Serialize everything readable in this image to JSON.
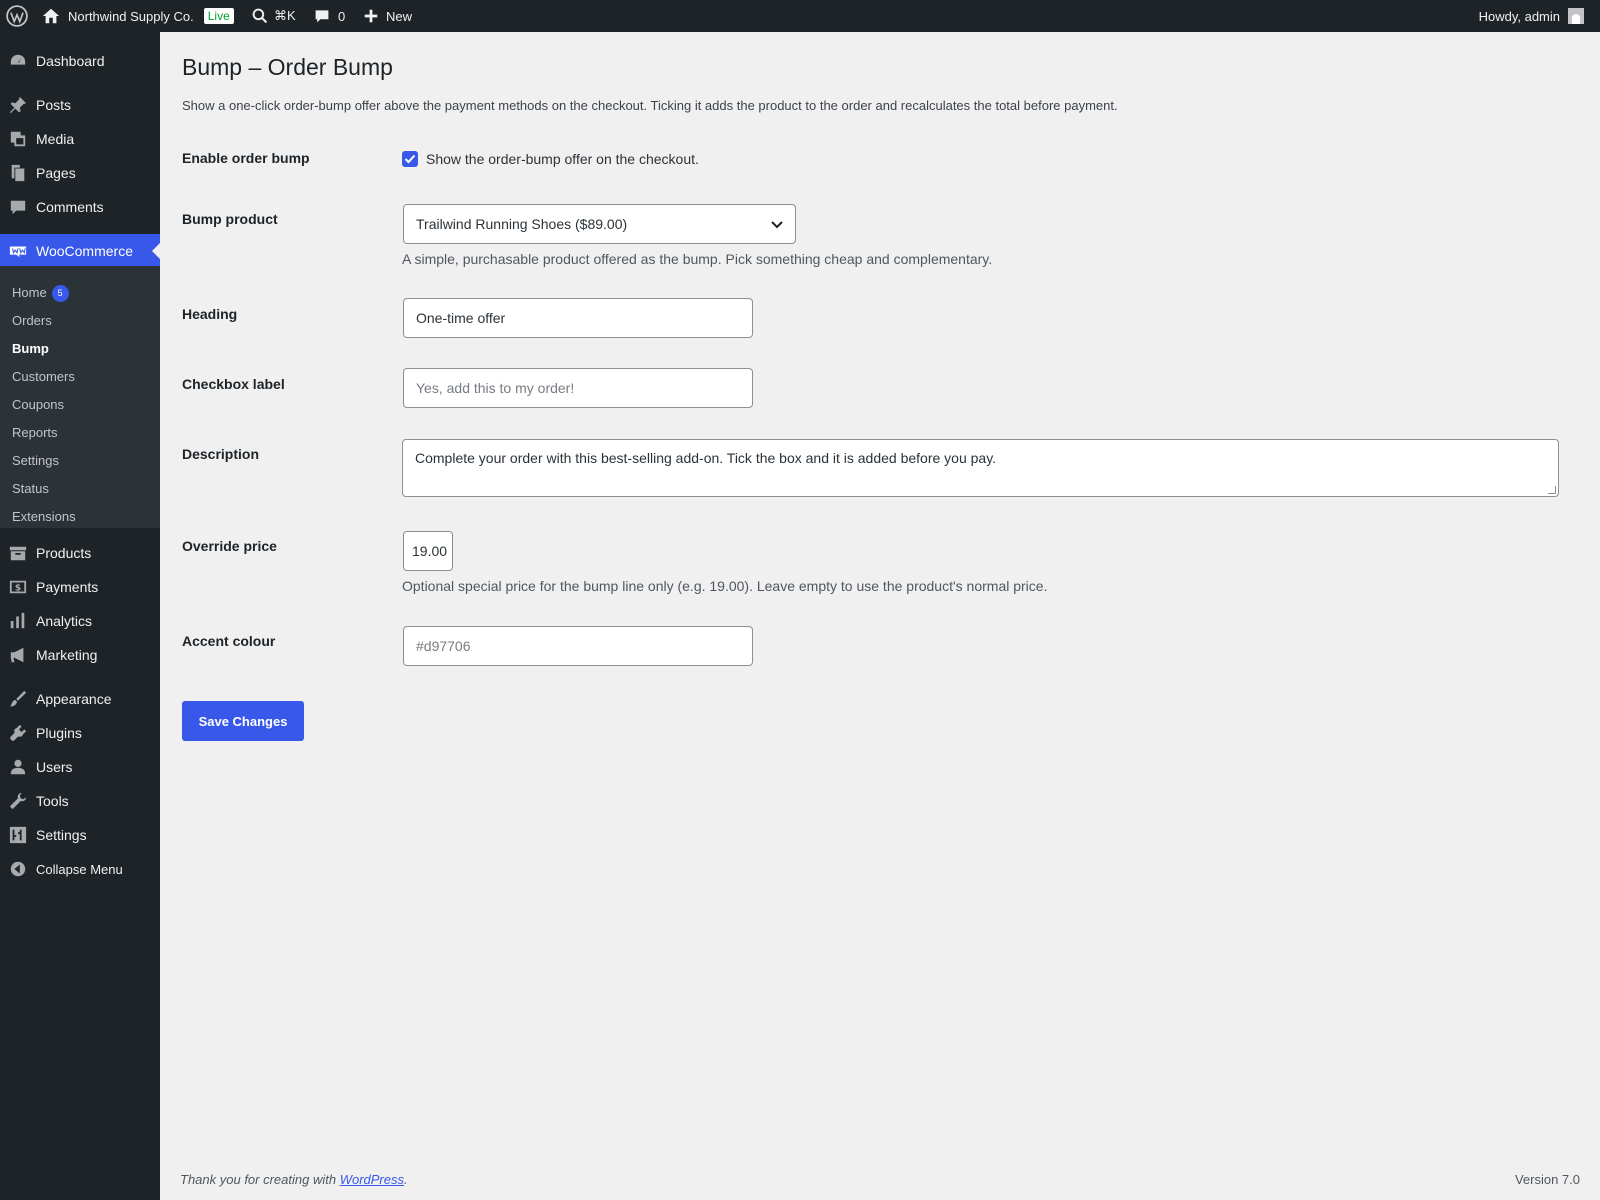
{
  "admin_bar": {
    "site_name": "Northwind Supply Co.",
    "live_badge": "Live",
    "search_shortcut": "⌘K",
    "comments_count": "0",
    "new_label": "New",
    "greeting": "Howdy, admin"
  },
  "sidebar": {
    "dashboard": "Dashboard",
    "posts": "Posts",
    "media": "Media",
    "pages": "Pages",
    "comments": "Comments",
    "woocommerce": "WooCommerce",
    "submenu": {
      "home": "Home",
      "home_badge": "5",
      "orders": "Orders",
      "bump": "Bump",
      "customers": "Customers",
      "coupons": "Coupons",
      "reports": "Reports",
      "settings": "Settings",
      "status": "Status",
      "extensions": "Extensions"
    },
    "products": "Products",
    "payments": "Payments",
    "analytics": "Analytics",
    "marketing": "Marketing",
    "appearance": "Appearance",
    "plugins": "Plugins",
    "users": "Users",
    "tools": "Tools",
    "settings": "Settings",
    "collapse": "Collapse Menu"
  },
  "page": {
    "title": "Bump – Order Bump",
    "intro": "Show a one-click order-bump offer above the payment methods on the checkout. Ticking it adds the product to the order and recalculates the total before payment."
  },
  "form": {
    "enable": {
      "label": "Enable order bump",
      "checkbox_label": "Show the order-bump offer on the checkout.",
      "checked": true
    },
    "product": {
      "label": "Bump product",
      "value": "Trailwind Running Shoes ($89.00)",
      "description": "A simple, purchasable product offered as the bump. Pick something cheap and complementary."
    },
    "heading": {
      "label": "Heading",
      "value": "One-time offer"
    },
    "checkbox_text": {
      "label": "Checkbox label",
      "placeholder": "Yes, add this to my order!"
    },
    "description": {
      "label": "Description",
      "value": "Complete your order with this best-selling add-on. Tick the box and it is added before you pay."
    },
    "override_price": {
      "label": "Override price",
      "value": "19.00",
      "description": "Optional special price for the bump line only (e.g. 19.00). Leave empty to use the product's normal price."
    },
    "accent": {
      "label": "Accent colour",
      "placeholder": "#d97706"
    },
    "save_label": "Save Changes"
  },
  "footer": {
    "thanks_prefix": "Thank you for creating with ",
    "wordpress_link": "WordPress",
    "thanks_suffix": ".",
    "version": "Version 7.0"
  },
  "colors": {
    "accent": "#3858e9",
    "sidebar_bg": "#1d2327",
    "submenu_bg": "#2c3338",
    "page_bg": "#f0f0f1",
    "live_badge": "#00a32a"
  }
}
